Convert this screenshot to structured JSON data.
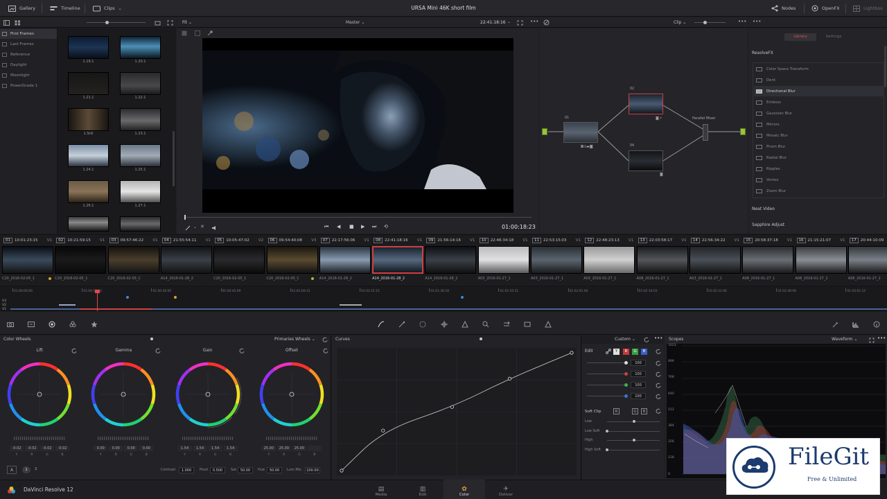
{
  "topbar": {
    "gallery": "Gallery",
    "timeline": "Timeline",
    "clips": "Clips",
    "project_title": "URSA Mini 46K short film",
    "nodes": "Nodes",
    "openfx": "OpenFX",
    "lightbox": "Lightbox"
  },
  "gallery": {
    "albums": [
      "First Frames",
      "Last Frames",
      "Reference",
      "Daylight",
      "Moonlight",
      "PowerGrade 1"
    ],
    "stills": [
      "1.19.1",
      "1.20.1",
      "1.21.1",
      "1.22.1",
      "1.Still",
      "1.23.1",
      "1.24.1",
      "1.25.1",
      "1.26.1",
      "1.27.1",
      "",
      ""
    ]
  },
  "viewer": {
    "zoom": "Fit",
    "mode": "Master",
    "timecode_top": "22:41:18:16",
    "timecode": "01:00:18:23"
  },
  "nodes_panel": {
    "mode": "Clip",
    "node_labels": [
      "01",
      "02",
      "04"
    ],
    "parallel_mixer": "Parallel Mixer"
  },
  "library": {
    "tab_library": "Library",
    "tab_settings": "Settings",
    "section": "ResolveFX",
    "effects": [
      "Color Space Transform",
      "Dent",
      "Directional Blur",
      "Emboss",
      "Gaussian Blur",
      "Mirrors",
      "Mosaic Blur",
      "Prism Blur",
      "Radial Blur",
      "Ripples",
      "Vortex",
      "Zoom Blur"
    ],
    "selected": "Directional Blur",
    "neat_video": "Neat Video",
    "sapphire": "Sapphire Adjust"
  },
  "clips": [
    {
      "n": "01",
      "tc": "10:01:23:15",
      "v": "V1",
      "name": "C20_2016-02-05_1"
    },
    {
      "n": "02",
      "tc": "10:21:59:15",
      "v": "V1",
      "name": "C20_2016-02-05_1"
    },
    {
      "n": "03",
      "tc": "09:57:46:22",
      "v": "V1",
      "name": "C20_2016-02-05_C"
    },
    {
      "n": "04",
      "tc": "21:55:54:11",
      "v": "V1",
      "name": "A14_2016-01-28_2"
    },
    {
      "n": "05",
      "tc": "10:05:47:02",
      "v": "V2",
      "name": "C20_2016-02-05_1"
    },
    {
      "n": "06",
      "tc": "09:54:40:08",
      "v": "V3",
      "name": "C20_2016-02-05_C"
    },
    {
      "n": "07",
      "tc": "22:17:56:06",
      "v": "V1",
      "name": "A14_2016-01-28_2"
    },
    {
      "n": "08",
      "tc": "22:41:18:16",
      "v": "V1",
      "name": "A14_2016-01-28_2"
    },
    {
      "n": "09",
      "tc": "21:56:14:16",
      "v": "V1",
      "name": "A14_2016-01-28_2"
    },
    {
      "n": "10",
      "tc": "22:46:34:18",
      "v": "V1",
      "name": "A03_2016-01-27_1"
    },
    {
      "n": "11",
      "tc": "22:53:15:03",
      "v": "V1",
      "name": "A03_2016-01-27_1"
    },
    {
      "n": "12",
      "tc": "22:48:23:13",
      "v": "V1",
      "name": "A03_2016-01-27_1"
    },
    {
      "n": "13",
      "tc": "22:03:58:17",
      "v": "V1",
      "name": "A08_2016-01-27_1"
    },
    {
      "n": "14",
      "tc": "22:56:34:22",
      "v": "V1",
      "name": "A03_2016-01-27_1"
    },
    {
      "n": "15",
      "tc": "20:58:37:18",
      "v": "V1",
      "name": "A08_2016-01-27_1"
    },
    {
      "n": "16",
      "tc": "21:15:21:07",
      "v": "V1",
      "name": "A08_2016-01-27_2"
    },
    {
      "n": "17",
      "tc": "20:44:10:09",
      "v": "V1",
      "name": "A08_2016-01-27_2"
    }
  ],
  "mini_timeline": {
    "tracks": [
      "V3",
      "V2",
      "V1"
    ],
    "ticks": [
      "01:00:00:00",
      "01:00:15:02",
      "01:00:30:05",
      "01:00:45:09",
      "01:01:00:12",
      "01:01:15:15",
      "01:01:30:18",
      "01:01:45:21",
      "01:02:01:00",
      "01:02:16:03",
      "01:02:31:06",
      "01:02:46:09",
      "01:03:01:12"
    ]
  },
  "color_wheels": {
    "title": "Color Wheels",
    "mode": "Primaries Wheels",
    "wheels": [
      {
        "label": "Lift",
        "values": [
          "-0.02",
          "-0.02",
          "-0.02",
          "-0.02"
        ]
      },
      {
        "label": "Gamma",
        "values": [
          "0.00",
          "0.00",
          "0.00",
          "0.00"
        ]
      },
      {
        "label": "Gain",
        "values": [
          "1.54",
          "1.54",
          "1.54",
          "1.54"
        ]
      },
      {
        "label": "Offset",
        "values": [
          "25.00",
          "25.00",
          "25.00",
          ""
        ]
      }
    ],
    "channels": [
      "Y",
      "R",
      "G",
      "B"
    ],
    "contrast_label": "Contrast",
    "contrast": "1.000",
    "pivot_label": "Pivot",
    "pivot": "0.500",
    "sat_label": "Sat",
    "sat": "50.00",
    "hue_label": "Hue",
    "hue": "50.00",
    "lummix_label": "Lum Mix",
    "lummix": "100.00",
    "page1": "1",
    "page2": "2"
  },
  "curves": {
    "title": "Curves",
    "mode": "Custom",
    "edit": "Edit",
    "chan_y": "Y",
    "chan_r": "R",
    "chan_g": "G",
    "chan_b": "B",
    "intensity": [
      "100",
      "100",
      "100",
      "100"
    ],
    "softclip": "Soft Clip",
    "softclip_rows": [
      "Low",
      "Low Soft",
      "High",
      "High Soft"
    ],
    "points": [
      [
        0,
        0
      ],
      [
        0.18,
        0.34
      ],
      [
        0.48,
        0.54
      ],
      [
        0.73,
        0.78
      ],
      [
        1,
        1
      ]
    ]
  },
  "scopes": {
    "title": "Scopes",
    "mode": "Waveform",
    "ticks": [
      "1023",
      "896",
      "768",
      "640",
      "512",
      "384",
      "256",
      "128",
      "0"
    ]
  },
  "watermark": {
    "name": "FileGit",
    "tagline": "Free & Unlimited"
  },
  "bottom": {
    "app": "DaVinci Resolve 12",
    "tabs": [
      "Media",
      "Edit",
      "Color",
      "Deliver"
    ],
    "active": "Color"
  },
  "colors": {
    "accent": "#e04848",
    "node_green": "#9ac43a",
    "text": "#a8a8ac"
  }
}
